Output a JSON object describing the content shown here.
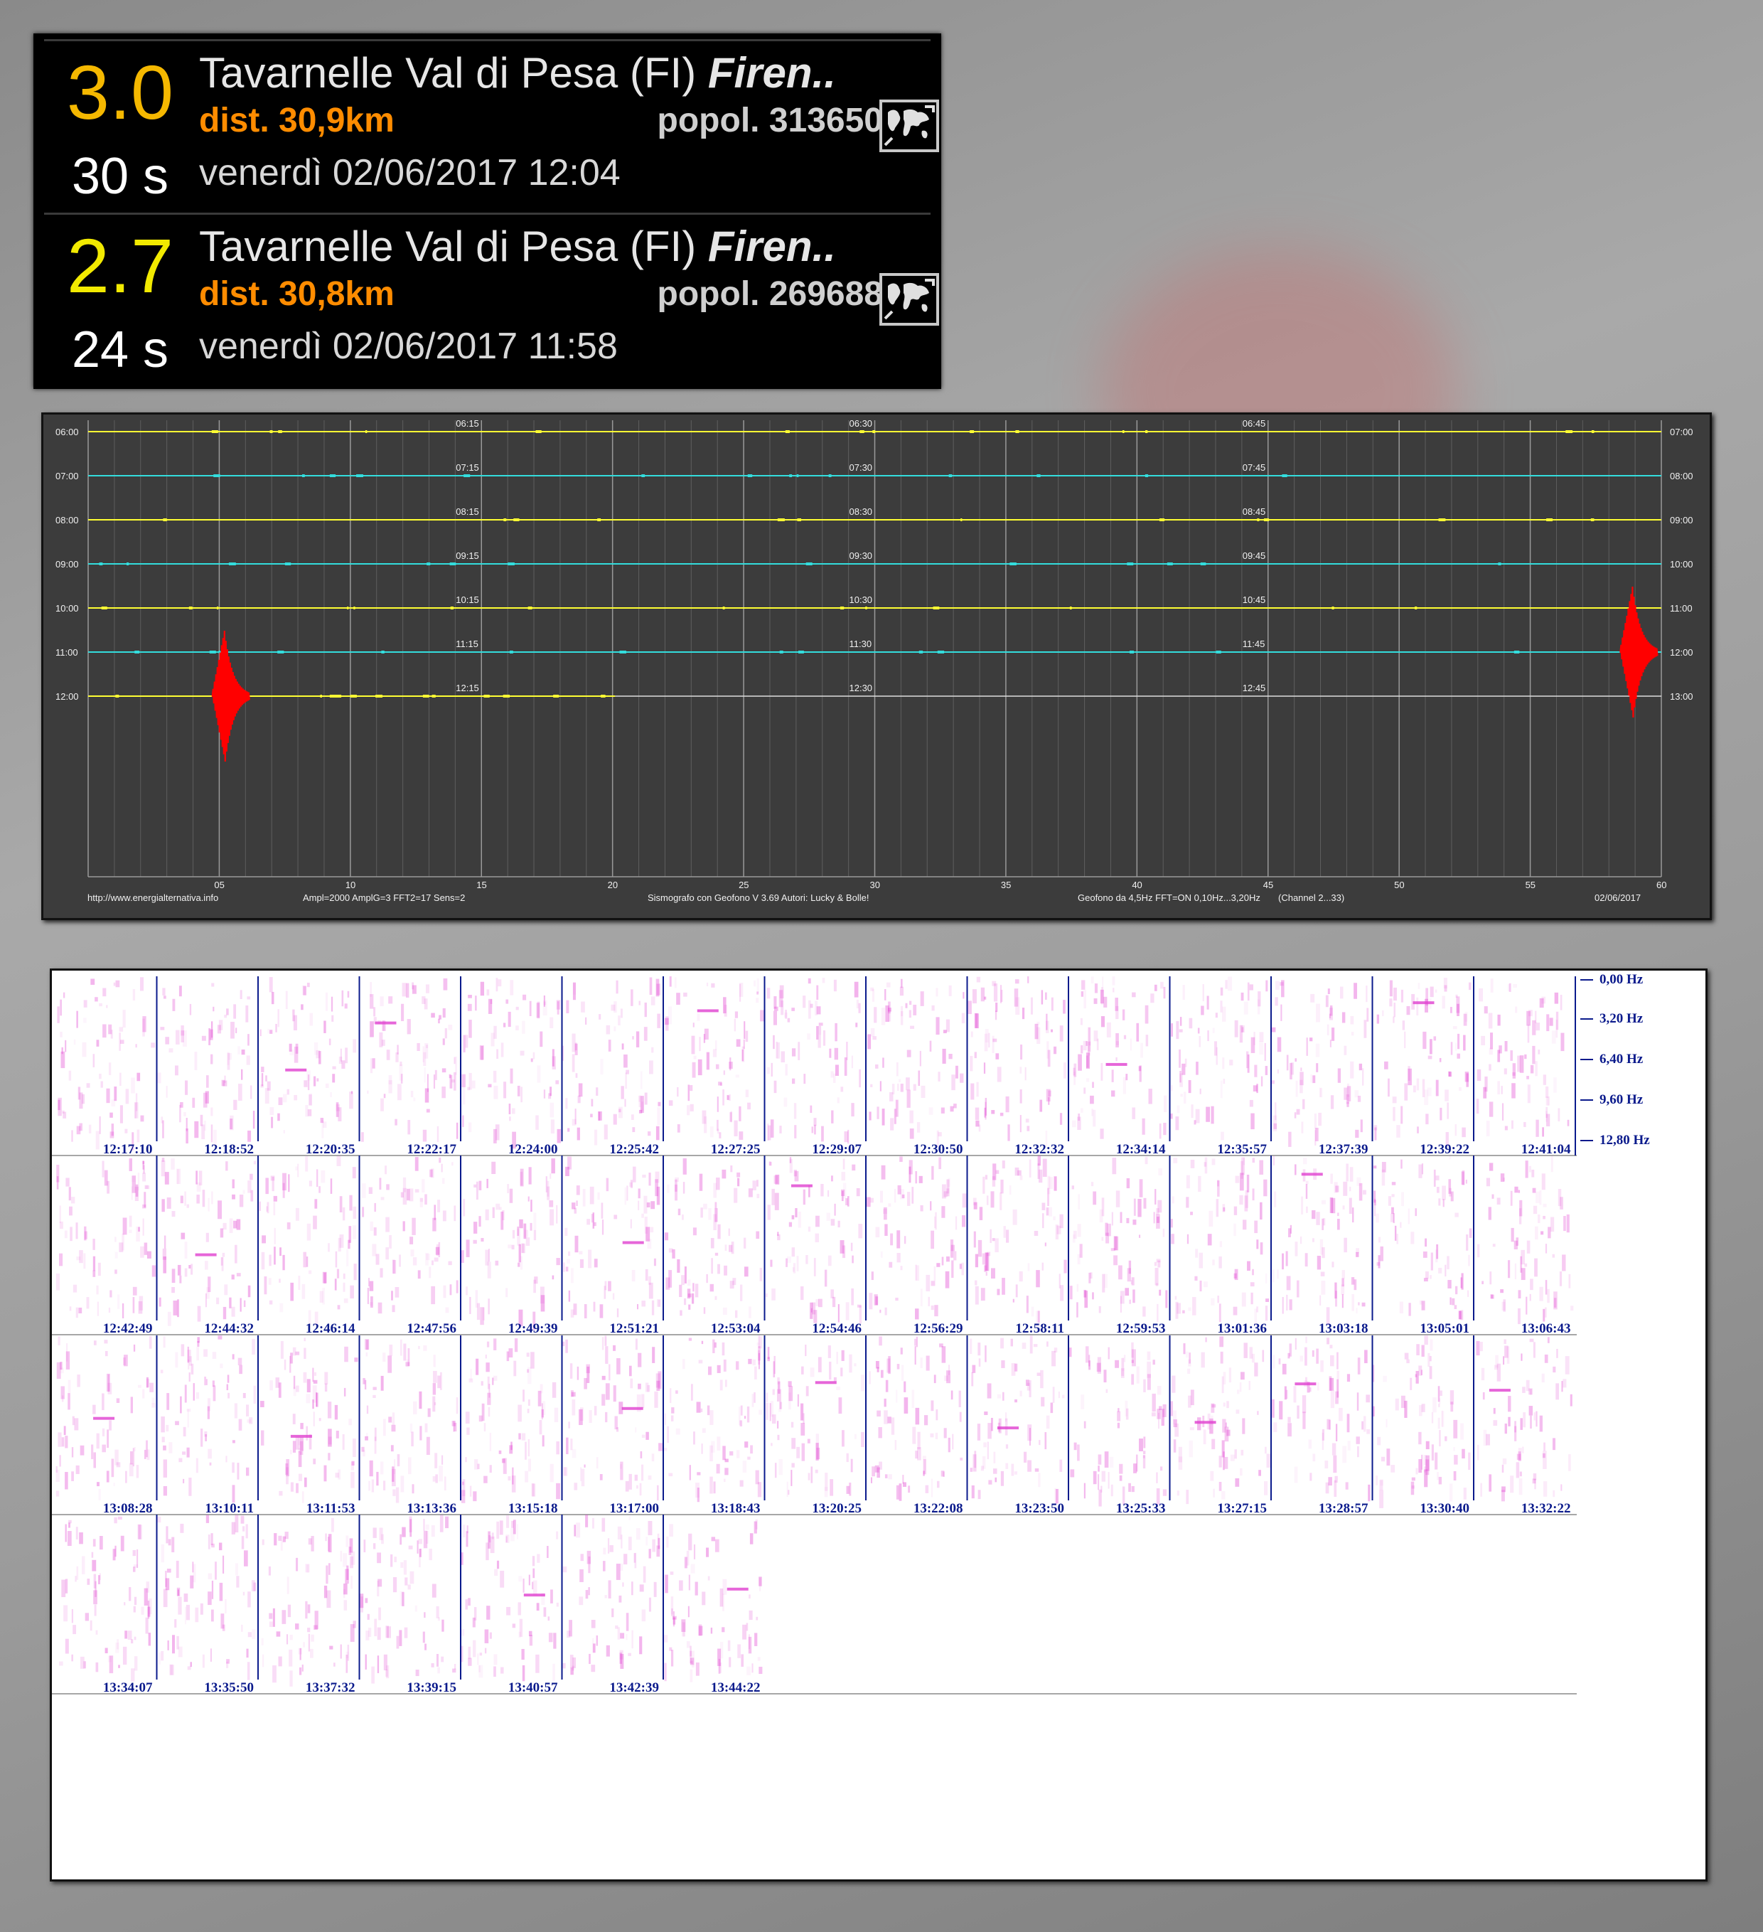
{
  "earthquakes": [
    {
      "magnitude": "3.0",
      "magnitude_color": "#f5b800",
      "elapsed": "30 s",
      "location": "Tavarnelle Val di Pesa (FI) ",
      "province": "Firen..",
      "distance": "dist. 30,9km",
      "population": "popol. 313650",
      "datetime": "venerdì 02/06/2017 12:04",
      "icon": "world-map-icon"
    },
    {
      "magnitude": "2.7",
      "magnitude_color": "#f2ea00",
      "elapsed": "24 s",
      "location": "Tavarnelle Val di Pesa (FI) ",
      "province": "Firen..",
      "distance": "dist. 30,8km",
      "population": "popol. 269688",
      "datetime": "venerdì 02/06/2017 11:58",
      "icon": "world-map-icon"
    }
  ],
  "seismograph": {
    "left_hours": [
      "06:00",
      "07:00",
      "08:00",
      "09:00",
      "10:00",
      "11:00",
      "12:00"
    ],
    "right_hours": [
      "07:00",
      "08:00",
      "09:00",
      "10:00",
      "11:00",
      "12:00",
      "13:00"
    ],
    "marks_15": [
      "06:15",
      "07:15",
      "08:15",
      "09:15",
      "10:15",
      "11:15",
      "12:15"
    ],
    "marks_30": [
      "06:30",
      "07:30",
      "08:30",
      "09:30",
      "10:30",
      "11:30",
      "12:30"
    ],
    "marks_45": [
      "06:45",
      "07:45",
      "08:45",
      "09:45",
      "10:45",
      "11:45",
      "12:45"
    ],
    "trace_colors": [
      "#ffff33",
      "#33dddd"
    ],
    "event_color": "#ff0000",
    "events": [
      {
        "trace_hour": "12:00",
        "minute": 5.2
      },
      {
        "trace_hour": "11:00",
        "minute": 58.9
      }
    ],
    "last_trace_end_minute": 20.1,
    "x_ticks": [
      "05",
      "10",
      "15",
      "20",
      "25",
      "30",
      "35",
      "40",
      "45",
      "50",
      "55",
      "60"
    ],
    "footer": {
      "url": "http://www.energialternativa.info",
      "settings": "Ampl=2000 AmplG=3 FFT2=17 Sens=2",
      "software": "Sismografo con Geofono V 3.69  Autori: Lucky & Bolle!",
      "sensor": "Geofono da 4,5Hz FFT=ON 0,10Hz...3,20Hz",
      "channel": "(Channel 2...33)",
      "date": "02/06/2017"
    }
  },
  "spectrogram": {
    "freq_labels": [
      "0,00 Hz",
      "3,20 Hz",
      "6,40 Hz",
      "9,60 Hz",
      "12,80 Hz"
    ],
    "rows": [
      [
        "12:17:10",
        "12:18:52",
        "12:20:35",
        "12:22:17",
        "12:24:00",
        "12:25:42",
        "12:27:25",
        "12:29:07",
        "12:30:50",
        "12:32:32",
        "12:34:14",
        "12:35:57",
        "12:37:39",
        "12:39:22",
        "12:41:04"
      ],
      [
        "12:42:49",
        "12:44:32",
        "12:46:14",
        "12:47:56",
        "12:49:39",
        "12:51:21",
        "12:53:04",
        "12:54:46",
        "12:56:29",
        "12:58:11",
        "12:59:53",
        "13:01:36",
        "13:03:18",
        "13:05:01",
        "13:06:43"
      ],
      [
        "13:08:28",
        "13:10:11",
        "13:11:53",
        "13:13:36",
        "13:15:18",
        "13:17:00",
        "13:18:43",
        "13:20:25",
        "13:22:08",
        "13:23:50",
        "13:25:33",
        "13:27:15",
        "13:28:57",
        "13:30:40",
        "13:32:22"
      ],
      [
        "13:34:07",
        "13:35:50",
        "13:37:32",
        "13:39:15",
        "13:40:57",
        "13:42:39",
        "13:44:22"
      ]
    ],
    "fill_color": "#e040d0"
  }
}
